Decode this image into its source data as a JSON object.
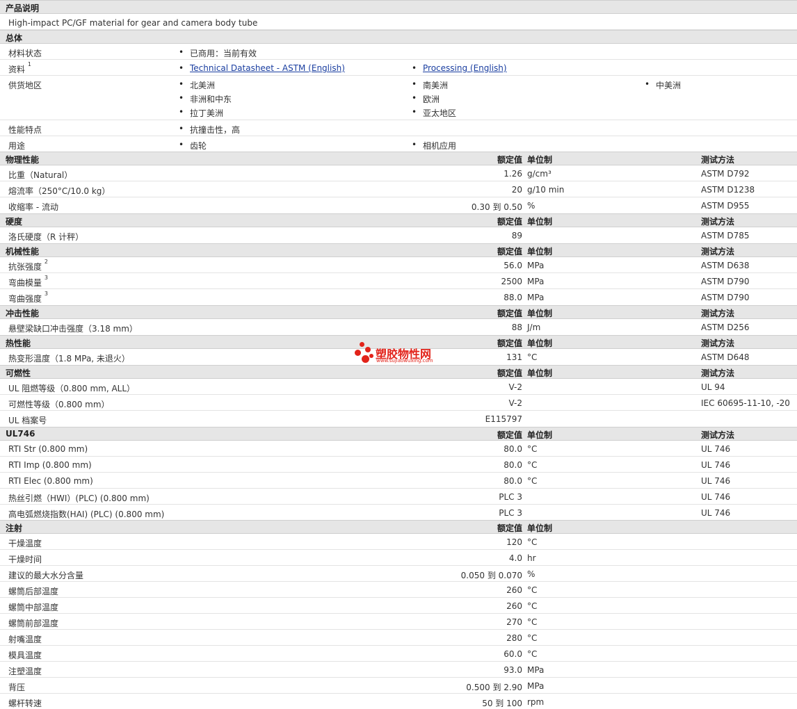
{
  "desc": {
    "title": "产品说明",
    "text": "High-impact PC/GF material for gear and camera body tube"
  },
  "general": {
    "title": "总体",
    "status": {
      "label": "材料状态",
      "value": "已商用：当前有效"
    },
    "docs": {
      "label": "资料",
      "sup": "1",
      "link1": "Technical Datasheet - ASTM (English)",
      "link2": "Processing (English)"
    },
    "regions": {
      "label": "供货地区",
      "items": [
        "北美洲",
        "南美洲",
        "中美洲",
        "非洲和中东",
        "欧洲",
        "拉丁美洲",
        "亚太地区"
      ]
    },
    "features": {
      "label": "性能特点",
      "value": "抗撞击性，高"
    },
    "uses": {
      "label": "用途",
      "items": [
        "齿轮",
        "相机应用"
      ]
    }
  },
  "headers": {
    "value": "额定值",
    "unit": "单位制",
    "test": "测试方法"
  },
  "physical": {
    "title": "物理性能",
    "rows": [
      {
        "label": "比重（Natural）",
        "value": "1.26",
        "unit": "g/cm³",
        "test": "ASTM D792"
      },
      {
        "label": "熔流率（250°C/10.0 kg）",
        "value": "20",
        "unit": "g/10 min",
        "test": "ASTM D1238"
      },
      {
        "label": "收缩率 - 流动",
        "value": "0.30 到  0.50",
        "unit": "%",
        "test": "ASTM D955"
      }
    ]
  },
  "hardness": {
    "title": "硬度",
    "rows": [
      {
        "label": "洛氏硬度（R 计秤）",
        "value": "89",
        "unit": "",
        "test": "ASTM D785"
      }
    ]
  },
  "mechanical": {
    "title": "机械性能",
    "rows": [
      {
        "label": "抗张强度",
        "sup": "2",
        "value": "56.0",
        "unit": "MPa",
        "test": "ASTM D638"
      },
      {
        "label": "弯曲模量",
        "sup": "3",
        "value": "2500",
        "unit": "MPa",
        "test": "ASTM D790"
      },
      {
        "label": "弯曲强度",
        "sup": "3",
        "value": "88.0",
        "unit": "MPa",
        "test": "ASTM D790"
      }
    ]
  },
  "impact": {
    "title": "冲击性能",
    "rows": [
      {
        "label": "悬壁梁缺口冲击强度（3.18 mm）",
        "value": "88",
        "unit": "J/m",
        "test": "ASTM D256"
      }
    ]
  },
  "thermal": {
    "title": "热性能",
    "rows": [
      {
        "label": "热变形温度（1.8 MPa, 未退火）",
        "value": "131",
        "unit": "°C",
        "test": "ASTM D648"
      }
    ]
  },
  "flammability": {
    "title": "可燃性",
    "rows": [
      {
        "label": "UL 阻燃等级（0.800 mm, ALL）",
        "value": "V-2",
        "unit": "",
        "test": "UL 94"
      },
      {
        "label": "可燃性等级（0.800 mm）",
        "value": "V-2",
        "unit": "",
        "test": "IEC 60695-11-10, -20"
      },
      {
        "label": "UL 档案号",
        "value": "E115797",
        "unit": "",
        "test": ""
      }
    ]
  },
  "ul746": {
    "title": "UL746",
    "rows": [
      {
        "label": "RTI Str (0.800 mm)",
        "value": "80.0",
        "unit": "°C",
        "test": "UL 746"
      },
      {
        "label": "RTI Imp (0.800 mm)",
        "value": "80.0",
        "unit": "°C",
        "test": "UL 746"
      },
      {
        "label": "RTI Elec (0.800 mm)",
        "value": "80.0",
        "unit": "°C",
        "test": "UL 746"
      },
      {
        "label": "热丝引燃（HWI）(PLC) (0.800 mm)",
        "value": "PLC 3",
        "unit": "",
        "test": "UL 746"
      },
      {
        "label": "高电弧燃烧指数(HAI) (PLC) (0.800 mm)",
        "value": "PLC 3",
        "unit": "",
        "test": "UL 746"
      }
    ]
  },
  "injection": {
    "title": "注射",
    "rows": [
      {
        "label": "干燥温度",
        "value": "120",
        "unit": "°C"
      },
      {
        "label": "干燥时间",
        "value": "4.0",
        "unit": "hr"
      },
      {
        "label": "建议的最大水分含量",
        "value": "0.050 到  0.070",
        "unit": "%"
      },
      {
        "label": "螺筒后部温度",
        "value": "260",
        "unit": "°C"
      },
      {
        "label": "螺筒中部温度",
        "value": "260",
        "unit": "°C"
      },
      {
        "label": "螺筒前部温度",
        "value": "270",
        "unit": "°C"
      },
      {
        "label": "射嘴温度",
        "value": "280",
        "unit": "°C"
      },
      {
        "label": "模具温度",
        "value": "60.0",
        "unit": "°C"
      },
      {
        "label": "注塑温度",
        "value": "93.0",
        "unit": "MPa"
      },
      {
        "label": "背压",
        "value": "0.500 到  2.90",
        "unit": "MPa"
      },
      {
        "label": "螺杆转速",
        "value": "50 到  100",
        "unit": "rpm"
      }
    ]
  },
  "watermark": {
    "cn": "塑胶物性网",
    "en": "www.sujiaowuxing.com",
    "color": "#e2231a"
  }
}
